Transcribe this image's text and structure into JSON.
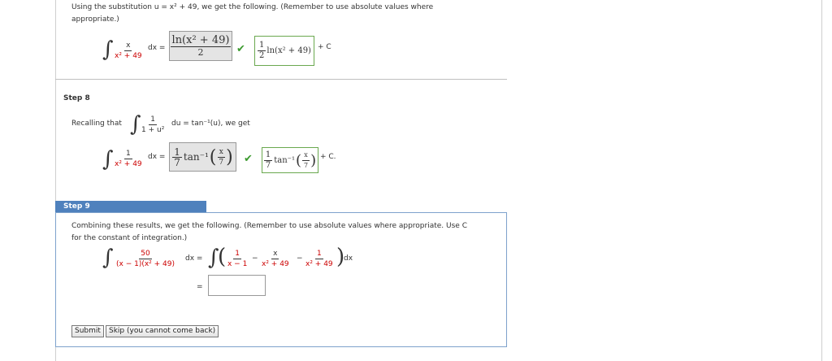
{
  "intro": {
    "line1": "Using the substitution u = x² + 49, we get the following. (Remember to use absolute values where",
    "line2": "appropriate.)"
  },
  "eq1": {
    "integrand_num": "x",
    "integrand_den": "x² + 49",
    "dx_eq": "dx =",
    "answer_num": "ln(x² + 49)",
    "answer_den": "2",
    "correct_num": "1",
    "correct_den": "2",
    "correct_rest": "ln(x² + 49)",
    "plus_c": "+ C"
  },
  "step8": {
    "label": "Step 8",
    "recalling": "Recalling that",
    "rec_num": "1",
    "rec_den": "1 + u²",
    "rec_rest": "du = tan⁻¹(u),  we get",
    "eq_num": "1",
    "eq_den": "x² + 49",
    "dx_eq": "dx =",
    "ans_coef_num": "1",
    "ans_coef_den": "7",
    "ans_fn": "tan⁻¹",
    "ans_arg_num": "x",
    "ans_arg_den": "7",
    "corr_coef_num": "1",
    "corr_coef_den": "7",
    "corr_fn": "tan⁻¹",
    "corr_arg_num": "x",
    "corr_arg_den": "7",
    "plus_c": "+ C."
  },
  "step9": {
    "label": "Step 9",
    "text1": "Combining these results, we get the following. (Remember to use absolute values where appropriate. Use C",
    "text2": "for the constant of integration.)",
    "lhs_num": "50",
    "lhs_den": "(x − 1)(x² + 49)",
    "dx_eq": "dx  =",
    "t1_num": "1",
    "t1_den": "x − 1",
    "minus": "−",
    "t2_num": "x",
    "t2_den": "x² + 49",
    "t3_num": "1",
    "t3_den": "x² + 49",
    "dx": "dx",
    "eq": "=",
    "input_value": ""
  },
  "buttons": {
    "submit": "Submit",
    "skip": "Skip (you cannot come back)"
  },
  "colors": {
    "accent": "#4f81bd",
    "correct": "#3c9a2f",
    "error": "#cc0000"
  }
}
